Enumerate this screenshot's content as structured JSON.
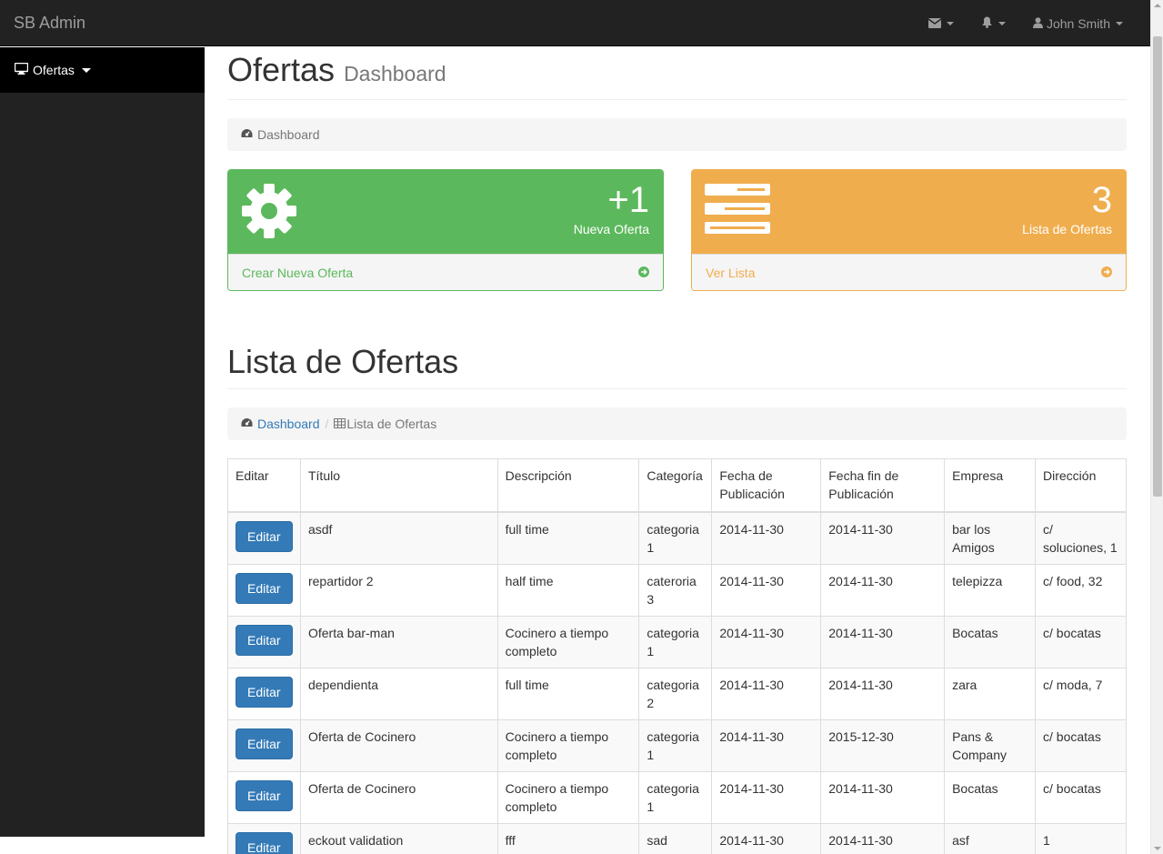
{
  "navbar": {
    "brand": "SB Admin",
    "user_name": "John Smith"
  },
  "sidebar": {
    "items": [
      {
        "label": "Ofertas"
      }
    ]
  },
  "header": {
    "title": "Ofertas",
    "subtitle": "Dashboard",
    "breadcrumb": "Dashboard"
  },
  "panels": {
    "new_offer": {
      "count": "+1",
      "label": "Nueva Oferta",
      "footer": "Crear Nueva Oferta",
      "color": "#5cb85c"
    },
    "offer_list": {
      "count": "3",
      "label": "Lista de Ofertas",
      "footer": "Ver Lista",
      "color": "#f0ad4e"
    }
  },
  "list_section": {
    "title": "Lista de Ofertas",
    "breadcrumb_link": "Dashboard",
    "breadcrumb_current": "Lista de Ofertas"
  },
  "table": {
    "headers": [
      "Editar",
      "Título",
      "Descripción",
      "Categoría",
      "Fecha de Publicación",
      "Fecha fin de Publicación",
      "Empresa",
      "Dirección"
    ],
    "edit_label": "Editar",
    "rows": [
      [
        "asdf",
        "full time",
        "categoria 1",
        "2014-11-30",
        "2014-11-30",
        "bar los Amigos",
        "c/ soluciones, 1"
      ],
      [
        "repartidor 2",
        "half time",
        "cateroria 3",
        "2014-11-30",
        "2014-11-30",
        "telepizza",
        "c/ food, 32"
      ],
      [
        "Oferta bar-man",
        "Cocinero a tiempo completo",
        "categoria 1",
        "2014-11-30",
        "2014-11-30",
        "Bocatas",
        "c/ bocatas"
      ],
      [
        "dependienta",
        "full time",
        "categoria 2",
        "2014-11-30",
        "2014-11-30",
        "zara",
        "c/ moda, 7"
      ],
      [
        "Oferta de Cocinero",
        "Cocinero a tiempo completo",
        "categoria 1",
        "2014-11-30",
        "2015-12-30",
        "Pans & Company",
        "c/ bocatas"
      ],
      [
        "Oferta de Cocinero",
        "Cocinero a tiempo completo",
        "categoria 1",
        "2014-11-30",
        "2014-11-30",
        "Bocatas",
        "c/ bocatas"
      ],
      [
        "eckout validation",
        "fff",
        "sad",
        "2014-11-30",
        "2014-11-30",
        "asf",
        "1"
      ]
    ]
  }
}
